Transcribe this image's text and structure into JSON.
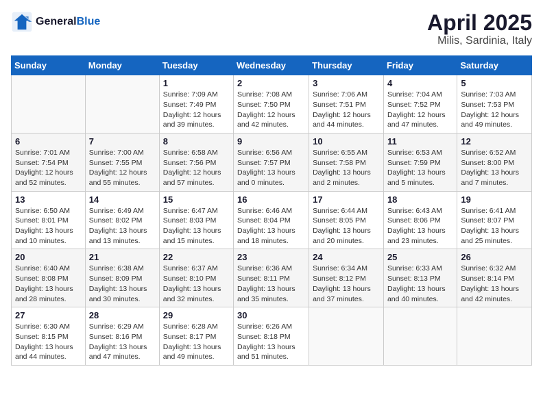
{
  "logo": {
    "line1": "General",
    "line2": "Blue"
  },
  "title": "April 2025",
  "subtitle": "Milis, Sardinia, Italy",
  "days_header": [
    "Sunday",
    "Monday",
    "Tuesday",
    "Wednesday",
    "Thursday",
    "Friday",
    "Saturday"
  ],
  "weeks": [
    [
      {
        "day": "",
        "info": ""
      },
      {
        "day": "",
        "info": ""
      },
      {
        "day": "1",
        "info": "Sunrise: 7:09 AM\nSunset: 7:49 PM\nDaylight: 12 hours and 39 minutes."
      },
      {
        "day": "2",
        "info": "Sunrise: 7:08 AM\nSunset: 7:50 PM\nDaylight: 12 hours and 42 minutes."
      },
      {
        "day": "3",
        "info": "Sunrise: 7:06 AM\nSunset: 7:51 PM\nDaylight: 12 hours and 44 minutes."
      },
      {
        "day": "4",
        "info": "Sunrise: 7:04 AM\nSunset: 7:52 PM\nDaylight: 12 hours and 47 minutes."
      },
      {
        "day": "5",
        "info": "Sunrise: 7:03 AM\nSunset: 7:53 PM\nDaylight: 12 hours and 49 minutes."
      }
    ],
    [
      {
        "day": "6",
        "info": "Sunrise: 7:01 AM\nSunset: 7:54 PM\nDaylight: 12 hours and 52 minutes."
      },
      {
        "day": "7",
        "info": "Sunrise: 7:00 AM\nSunset: 7:55 PM\nDaylight: 12 hours and 55 minutes."
      },
      {
        "day": "8",
        "info": "Sunrise: 6:58 AM\nSunset: 7:56 PM\nDaylight: 12 hours and 57 minutes."
      },
      {
        "day": "9",
        "info": "Sunrise: 6:56 AM\nSunset: 7:57 PM\nDaylight: 13 hours and 0 minutes."
      },
      {
        "day": "10",
        "info": "Sunrise: 6:55 AM\nSunset: 7:58 PM\nDaylight: 13 hours and 2 minutes."
      },
      {
        "day": "11",
        "info": "Sunrise: 6:53 AM\nSunset: 7:59 PM\nDaylight: 13 hours and 5 minutes."
      },
      {
        "day": "12",
        "info": "Sunrise: 6:52 AM\nSunset: 8:00 PM\nDaylight: 13 hours and 7 minutes."
      }
    ],
    [
      {
        "day": "13",
        "info": "Sunrise: 6:50 AM\nSunset: 8:01 PM\nDaylight: 13 hours and 10 minutes."
      },
      {
        "day": "14",
        "info": "Sunrise: 6:49 AM\nSunset: 8:02 PM\nDaylight: 13 hours and 13 minutes."
      },
      {
        "day": "15",
        "info": "Sunrise: 6:47 AM\nSunset: 8:03 PM\nDaylight: 13 hours and 15 minutes."
      },
      {
        "day": "16",
        "info": "Sunrise: 6:46 AM\nSunset: 8:04 PM\nDaylight: 13 hours and 18 minutes."
      },
      {
        "day": "17",
        "info": "Sunrise: 6:44 AM\nSunset: 8:05 PM\nDaylight: 13 hours and 20 minutes."
      },
      {
        "day": "18",
        "info": "Sunrise: 6:43 AM\nSunset: 8:06 PM\nDaylight: 13 hours and 23 minutes."
      },
      {
        "day": "19",
        "info": "Sunrise: 6:41 AM\nSunset: 8:07 PM\nDaylight: 13 hours and 25 minutes."
      }
    ],
    [
      {
        "day": "20",
        "info": "Sunrise: 6:40 AM\nSunset: 8:08 PM\nDaylight: 13 hours and 28 minutes."
      },
      {
        "day": "21",
        "info": "Sunrise: 6:38 AM\nSunset: 8:09 PM\nDaylight: 13 hours and 30 minutes."
      },
      {
        "day": "22",
        "info": "Sunrise: 6:37 AM\nSunset: 8:10 PM\nDaylight: 13 hours and 32 minutes."
      },
      {
        "day": "23",
        "info": "Sunrise: 6:36 AM\nSunset: 8:11 PM\nDaylight: 13 hours and 35 minutes."
      },
      {
        "day": "24",
        "info": "Sunrise: 6:34 AM\nSunset: 8:12 PM\nDaylight: 13 hours and 37 minutes."
      },
      {
        "day": "25",
        "info": "Sunrise: 6:33 AM\nSunset: 8:13 PM\nDaylight: 13 hours and 40 minutes."
      },
      {
        "day": "26",
        "info": "Sunrise: 6:32 AM\nSunset: 8:14 PM\nDaylight: 13 hours and 42 minutes."
      }
    ],
    [
      {
        "day": "27",
        "info": "Sunrise: 6:30 AM\nSunset: 8:15 PM\nDaylight: 13 hours and 44 minutes."
      },
      {
        "day": "28",
        "info": "Sunrise: 6:29 AM\nSunset: 8:16 PM\nDaylight: 13 hours and 47 minutes."
      },
      {
        "day": "29",
        "info": "Sunrise: 6:28 AM\nSunset: 8:17 PM\nDaylight: 13 hours and 49 minutes."
      },
      {
        "day": "30",
        "info": "Sunrise: 6:26 AM\nSunset: 8:18 PM\nDaylight: 13 hours and 51 minutes."
      },
      {
        "day": "",
        "info": ""
      },
      {
        "day": "",
        "info": ""
      },
      {
        "day": "",
        "info": ""
      }
    ]
  ]
}
